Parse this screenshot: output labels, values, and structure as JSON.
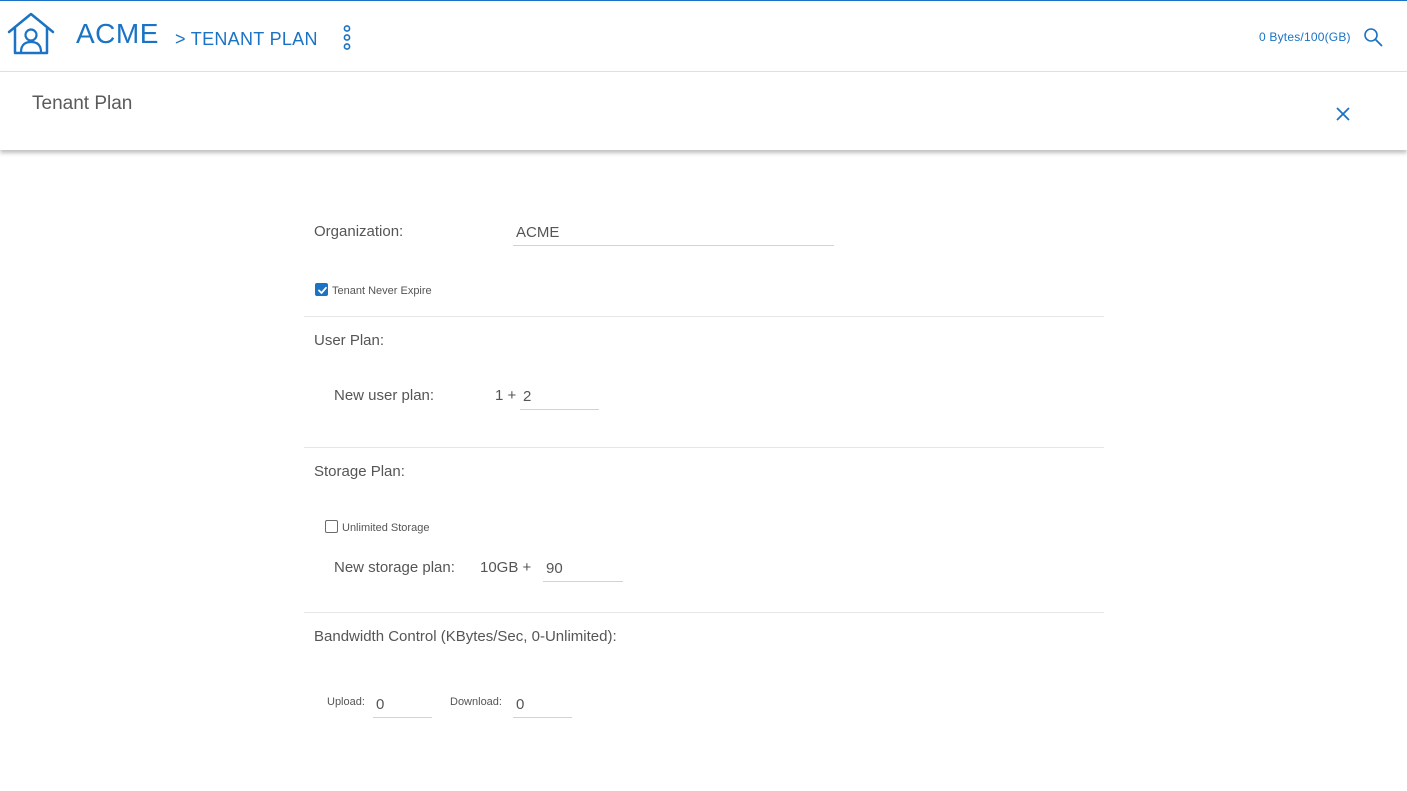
{
  "header": {
    "brand": "ACME",
    "breadcrumb": "> TENANT PLAN",
    "storage_used": "0 Bytes",
    "storage_separator": "/",
    "storage_total": "100(GB)",
    "accent_color": "#1a73c4"
  },
  "panel": {
    "title": "Tenant Plan"
  },
  "form": {
    "organization": {
      "label": "Organization:",
      "value": "ACME"
    },
    "never_expire": {
      "label": "Tenant Never Expire",
      "checked": true
    },
    "user_plan": {
      "section_label": "User Plan:",
      "label": "New user plan:",
      "prefix": "1 +",
      "value": "2"
    },
    "storage_plan": {
      "section_label": "Storage Plan:",
      "unlimited": {
        "label": "Unlimited Storage",
        "checked": false
      },
      "label": "New storage plan:",
      "prefix": "10GB +",
      "value": "90"
    },
    "bandwidth": {
      "section_label": "Bandwidth Control (KBytes/Sec, 0-Unlimited):",
      "upload_label": "Upload:",
      "upload_value": "0",
      "download_label": "Download:",
      "download_value": "0"
    }
  }
}
